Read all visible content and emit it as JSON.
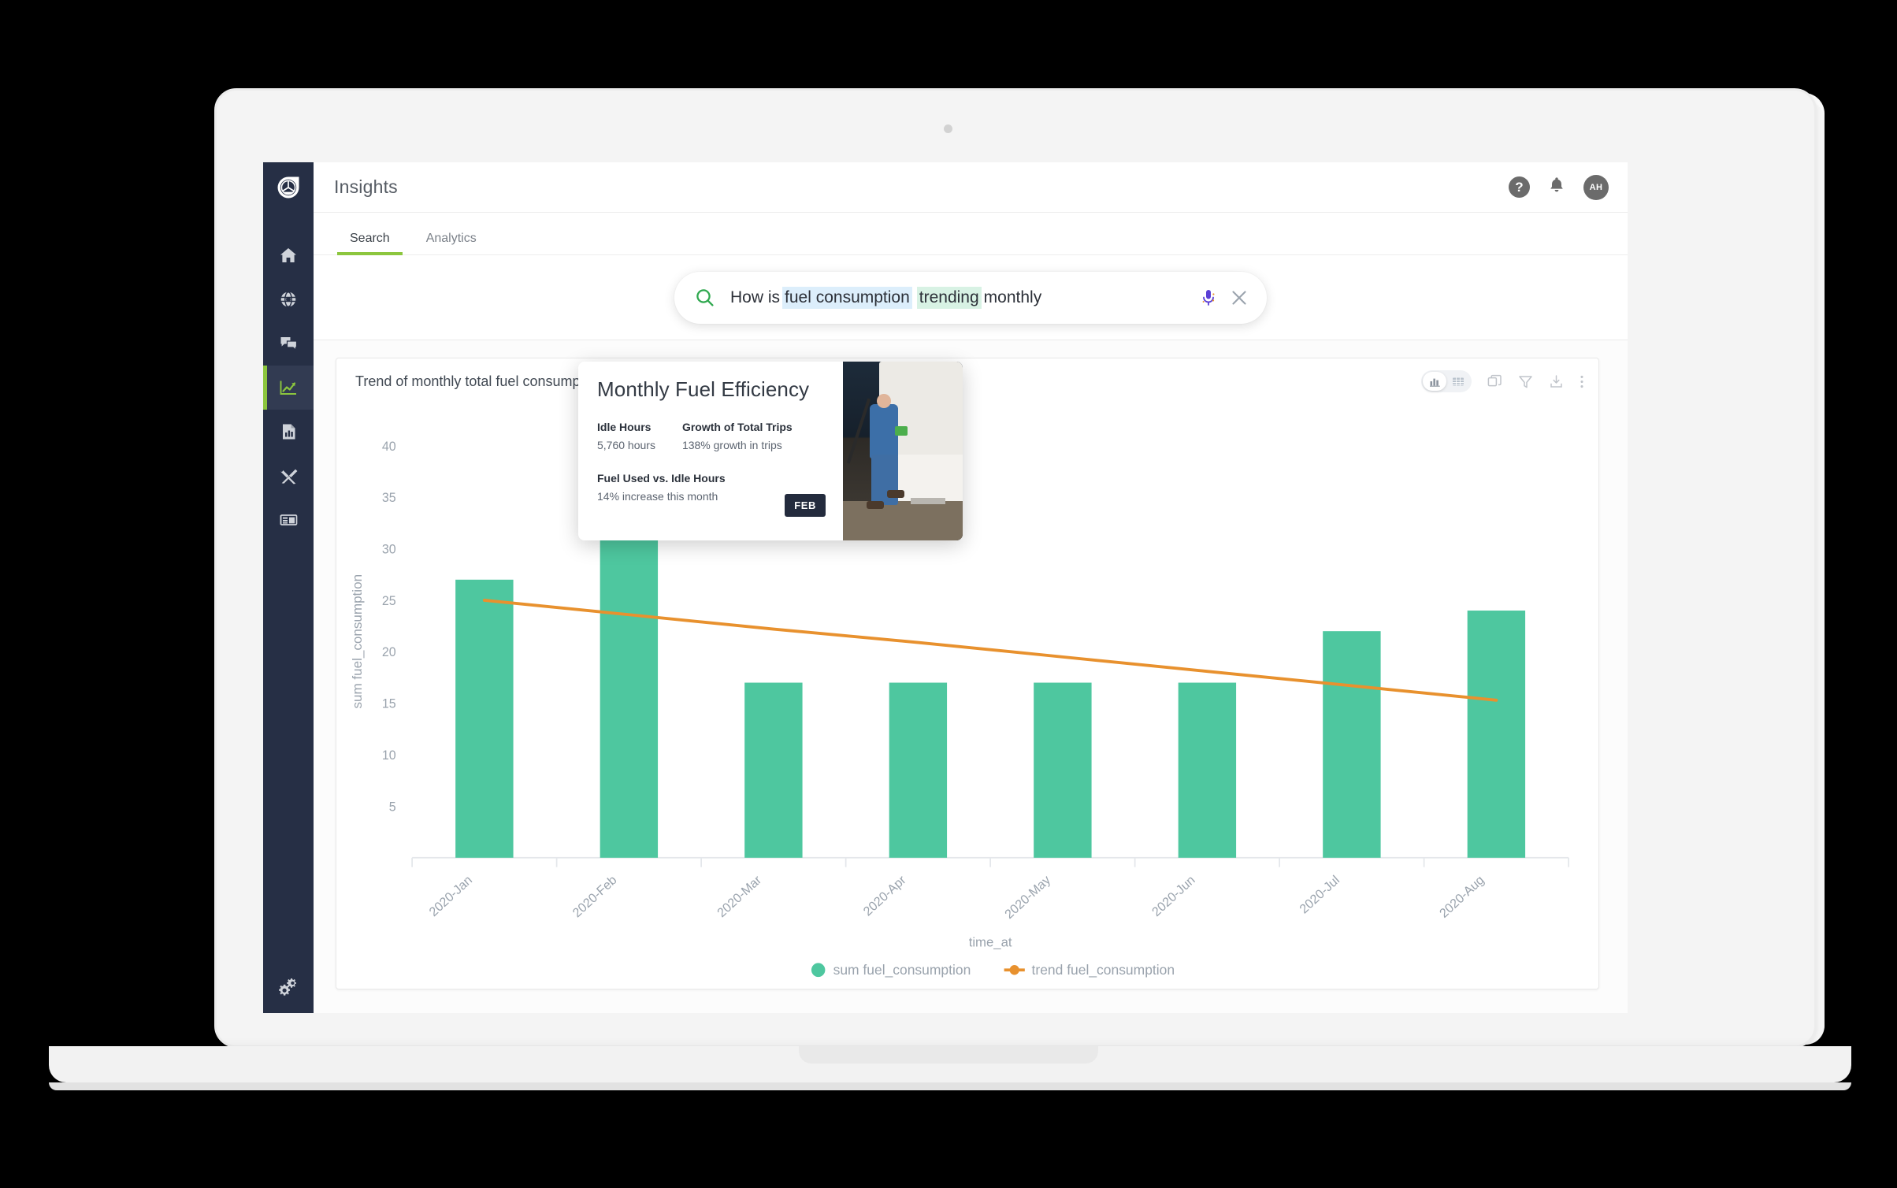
{
  "app": {
    "title": "Insights",
    "logo_icon": "logo-mark-icon"
  },
  "header": {
    "help_icon": "help-icon",
    "help_glyph": "?",
    "notifications_icon": "bell-icon",
    "avatar_initials": "AH"
  },
  "sidebar": {
    "items": [
      {
        "name": "home",
        "icon": "home-icon",
        "active": false
      },
      {
        "name": "network",
        "icon": "globe-icon",
        "active": false
      },
      {
        "name": "messages",
        "icon": "chat-icon",
        "active": false
      },
      {
        "name": "insights",
        "icon": "trending-chart-icon",
        "active": true
      },
      {
        "name": "reports",
        "icon": "report-document-icon",
        "active": false
      },
      {
        "name": "tools",
        "icon": "wrench-screwdriver-icon",
        "active": false
      },
      {
        "name": "data",
        "icon": "table-list-icon",
        "active": false
      }
    ],
    "settings_icon": "gears-icon"
  },
  "tabs": [
    {
      "label": "Search",
      "active": true
    },
    {
      "label": "Analytics",
      "active": false
    }
  ],
  "search": {
    "icon": "search-magnifier-icon",
    "mic_icon": "microphone-icon",
    "clear_icon": "close-x-icon",
    "tokens": [
      {
        "text": "How is ",
        "highlight": "none"
      },
      {
        "text": "fuel consumption",
        "highlight": "blue"
      },
      {
        "text": " ",
        "highlight": "none"
      },
      {
        "text": "trending",
        "highlight": "green"
      },
      {
        "text": " monthly",
        "highlight": "none"
      }
    ],
    "full_text": "How is fuel consumption trending monthly"
  },
  "card": {
    "title": "Trend of monthly total fuel consumption",
    "tools": [
      {
        "name": "chart-view-toggle",
        "icon": "bar-chart-icon",
        "selected": true
      },
      {
        "name": "table-view-toggle",
        "icon": "table-grid-icon",
        "selected": false
      },
      {
        "name": "duplicate-button",
        "icon": "copy-icon"
      },
      {
        "name": "filter-button",
        "icon": "funnel-filter-icon"
      },
      {
        "name": "download-button",
        "icon": "download-icon"
      },
      {
        "name": "more-options-button",
        "icon": "kebab-menu-icon"
      }
    ]
  },
  "callout": {
    "title": "Monthly Fuel Efficiency",
    "stats": [
      {
        "label": "Idle Hours",
        "value": "5,760 hours"
      },
      {
        "label": "Growth of Total Trips",
        "value": "138% growth in trips"
      },
      {
        "label": "Fuel Used vs. Idle Hours",
        "value": "14% increase this month"
      }
    ],
    "month_chip": "FEB",
    "photo_alt": "technician-refueling-truck-photo"
  },
  "colors": {
    "bar_green": "#4ec79f",
    "trend_orange": "#e8912e",
    "accent_green": "#8cc63e",
    "sidebar_navy": "#262f45",
    "chip_navy": "#232b3d",
    "highlight_blue": "#dceefb",
    "highlight_green": "#d8f2e4"
  },
  "chart_data": {
    "type": "bar",
    "title": "Trend of monthly total fuel consumption",
    "xlabel": "time_at",
    "ylabel": "sum fuel_consumption",
    "categories": [
      "2020-Jan",
      "2020-Feb",
      "2020-Mar",
      "2020-Apr",
      "2020-May",
      "2020-Jun",
      "2020-Jul",
      "2020-Aug"
    ],
    "yticks": [
      5,
      10,
      15,
      20,
      25,
      30,
      35,
      40
    ],
    "ylim": [
      0,
      42
    ],
    "grid": false,
    "legend_position": "bottom",
    "series": [
      {
        "name": "sum fuel_consumption",
        "type": "bar",
        "color": "#4ec79f",
        "values": [
          27,
          39,
          17,
          17,
          17,
          17,
          22,
          24
        ]
      },
      {
        "name": "trend fuel_consumption",
        "type": "line",
        "color": "#e8912e",
        "values": [
          25.0,
          23.6,
          22.2,
          20.9,
          19.5,
          18.1,
          16.7,
          15.3
        ]
      }
    ],
    "annotation": {
      "anchor_category": "2020-Feb",
      "anchor_value": 37,
      "marker_icon": "orange-ring-marker",
      "connector": "dotted-line"
    }
  }
}
